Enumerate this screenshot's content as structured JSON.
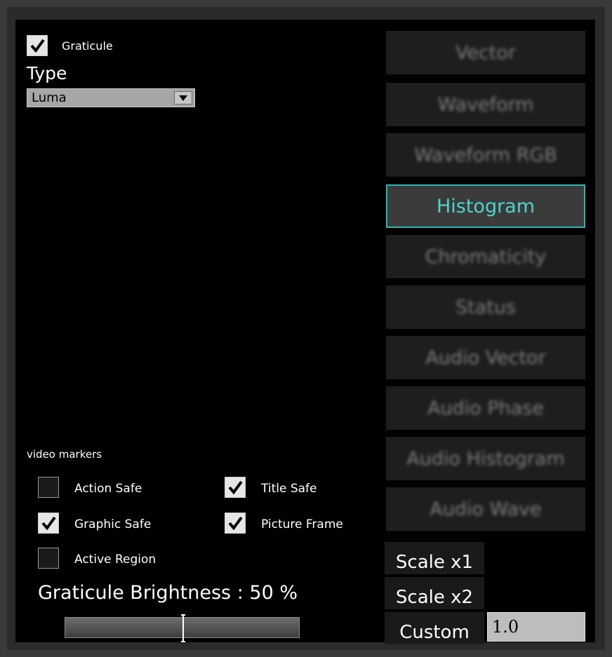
{
  "graticule": {
    "label": "Graticule",
    "checked": true
  },
  "type_section": {
    "label": "Type",
    "selected": "Luma"
  },
  "modes": [
    {
      "label": "Vector",
      "active": false
    },
    {
      "label": "Waveform",
      "active": false
    },
    {
      "label": "Waveform RGB",
      "active": false
    },
    {
      "label": "Histogram",
      "active": true
    },
    {
      "label": "Chromaticity",
      "active": false
    },
    {
      "label": "Status",
      "active": false
    },
    {
      "label": "Audio Vector",
      "active": false
    },
    {
      "label": "Audio Phase",
      "active": false
    },
    {
      "label": "Audio Histogram",
      "active": false
    },
    {
      "label": "Audio Wave",
      "active": false
    }
  ],
  "video_markers": {
    "heading": "video markers",
    "items": [
      {
        "label": "Action Safe",
        "checked": false
      },
      {
        "label": "Title Safe",
        "checked": true
      },
      {
        "label": "Graphic Safe",
        "checked": true
      },
      {
        "label": "Picture Frame",
        "checked": true
      },
      {
        "label": "Active Region",
        "checked": false
      }
    ]
  },
  "brightness": {
    "label": "Graticule Brightness : 50 %",
    "value_percent": 50
  },
  "scale": {
    "x1_label": "Scale x1",
    "x2_label": "Scale x2",
    "custom_label": "Custom",
    "custom_value": "1.0"
  },
  "colors": {
    "accent": "#2fb5b0",
    "panel": "#000000",
    "frame": "#2b2b2b"
  }
}
